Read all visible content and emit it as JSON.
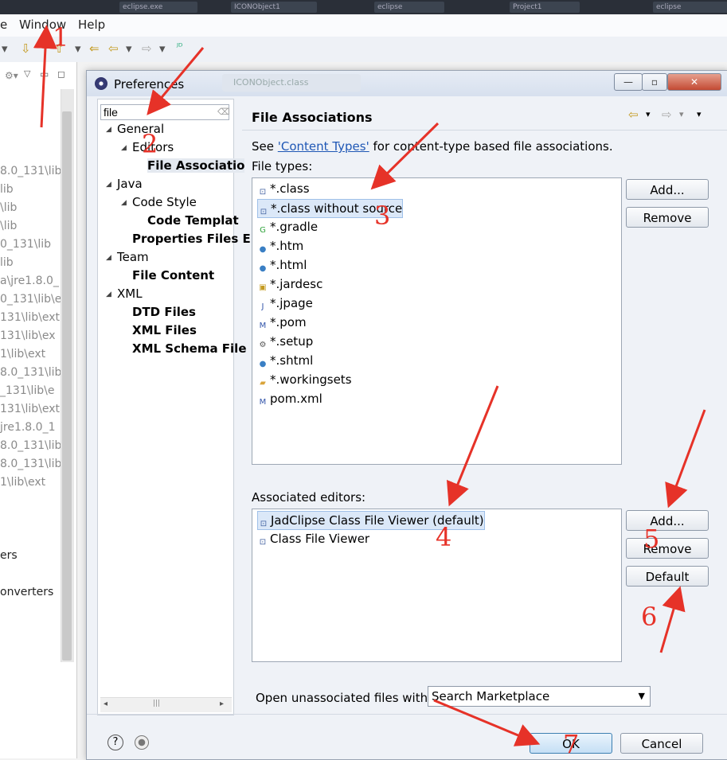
{
  "taskbar": {
    "items": [
      "eclipse.exe",
      "ICONObject1",
      "eclipse",
      "Project1",
      "eclipse"
    ]
  },
  "menubar": {
    "items": [
      "e",
      "Window",
      "Help"
    ]
  },
  "bg_explorer": {
    "lines": [
      "8.0_131\\lib",
      "lib",
      "\\lib",
      "\\lib",
      "0_131\\lib",
      "lib",
      "a\\jre1.8.0_",
      "0_131\\lib\\e",
      "131\\lib\\ext",
      "131\\lib\\ex",
      "1\\lib\\ext",
      "8.0_131\\lib",
      "_131\\lib\\e",
      "131\\lib\\ext",
      "jre1.8.0_1",
      "8.0_131\\lib",
      "8.0_131\\lib",
      "1\\lib\\ext",
      "ers",
      "onverters"
    ]
  },
  "bg_editor_tab": "ICONObject.class",
  "dialog": {
    "title": "Preferences",
    "filter_value": "file",
    "tree": [
      {
        "label": "General",
        "level": 0,
        "bold": false,
        "expanded": true
      },
      {
        "label": "Editors",
        "level": 1,
        "bold": false,
        "expanded": true
      },
      {
        "label": "File Associatio",
        "level": 2,
        "bold": true,
        "selected": true
      },
      {
        "label": "Java",
        "level": 0,
        "bold": false,
        "expanded": true
      },
      {
        "label": "Code Style",
        "level": 1,
        "bold": false,
        "expanded": true
      },
      {
        "label": "Code Templat",
        "level": 2,
        "bold": true
      },
      {
        "label": "Properties Files E",
        "level": 1,
        "bold": true
      },
      {
        "label": "Team",
        "level": 0,
        "bold": false,
        "expanded": true
      },
      {
        "label": "File Content",
        "level": 1,
        "bold": true
      },
      {
        "label": "XML",
        "level": 0,
        "bold": false,
        "expanded": true
      },
      {
        "label": "DTD Files",
        "level": 1,
        "bold": true
      },
      {
        "label": "XML Files",
        "level": 1,
        "bold": true
      },
      {
        "label": "XML Schema File",
        "level": 1,
        "bold": true
      }
    ],
    "page_title": "File Associations",
    "see_prefix": "See",
    "see_link": "'Content Types'",
    "see_suffix": "for content-type based file associations.",
    "file_types_label": "File types:",
    "file_types": [
      {
        "label": "*.class",
        "icon": "class-file-icon"
      },
      {
        "label": "*.class without source",
        "icon": "class-file-icon",
        "selected": true
      },
      {
        "label": "*.gradle",
        "icon": "gradle-icon"
      },
      {
        "label": "*.htm",
        "icon": "globe-icon"
      },
      {
        "label": "*.html",
        "icon": "globe-icon"
      },
      {
        "label": "*.jardesc",
        "icon": "jardesc-icon"
      },
      {
        "label": "*.jpage",
        "icon": "jpage-icon"
      },
      {
        "label": "*.pom",
        "icon": "maven-icon"
      },
      {
        "label": "*.setup",
        "icon": "setup-icon"
      },
      {
        "label": "*.shtml",
        "icon": "globe-icon"
      },
      {
        "label": "*.workingsets",
        "icon": "folder-icon"
      },
      {
        "label": "pom.xml",
        "icon": "maven-icon"
      }
    ],
    "file_types_add": "Add...",
    "file_types_remove": "Remove",
    "assoc_label": "Associated editors:",
    "assoc_editors": [
      {
        "label": "JadClipse Class File Viewer (default)",
        "icon": "class-file-icon",
        "selected": true
      },
      {
        "label": "Class File Viewer",
        "icon": "class-file-icon"
      }
    ],
    "assoc_add": "Add...",
    "assoc_remove": "Remove",
    "assoc_default": "Default",
    "open_unassoc_label": "Open unassociated files with:",
    "open_unassoc_value": "Search Marketplace",
    "ok": "OK",
    "cancel": "Cancel"
  },
  "annotations": [
    "1",
    "2",
    "3",
    "4",
    "5",
    "6",
    "7"
  ],
  "colors": {
    "annotation": "#e63228",
    "link": "#1f57b5",
    "selection": "#dbe8f8"
  }
}
